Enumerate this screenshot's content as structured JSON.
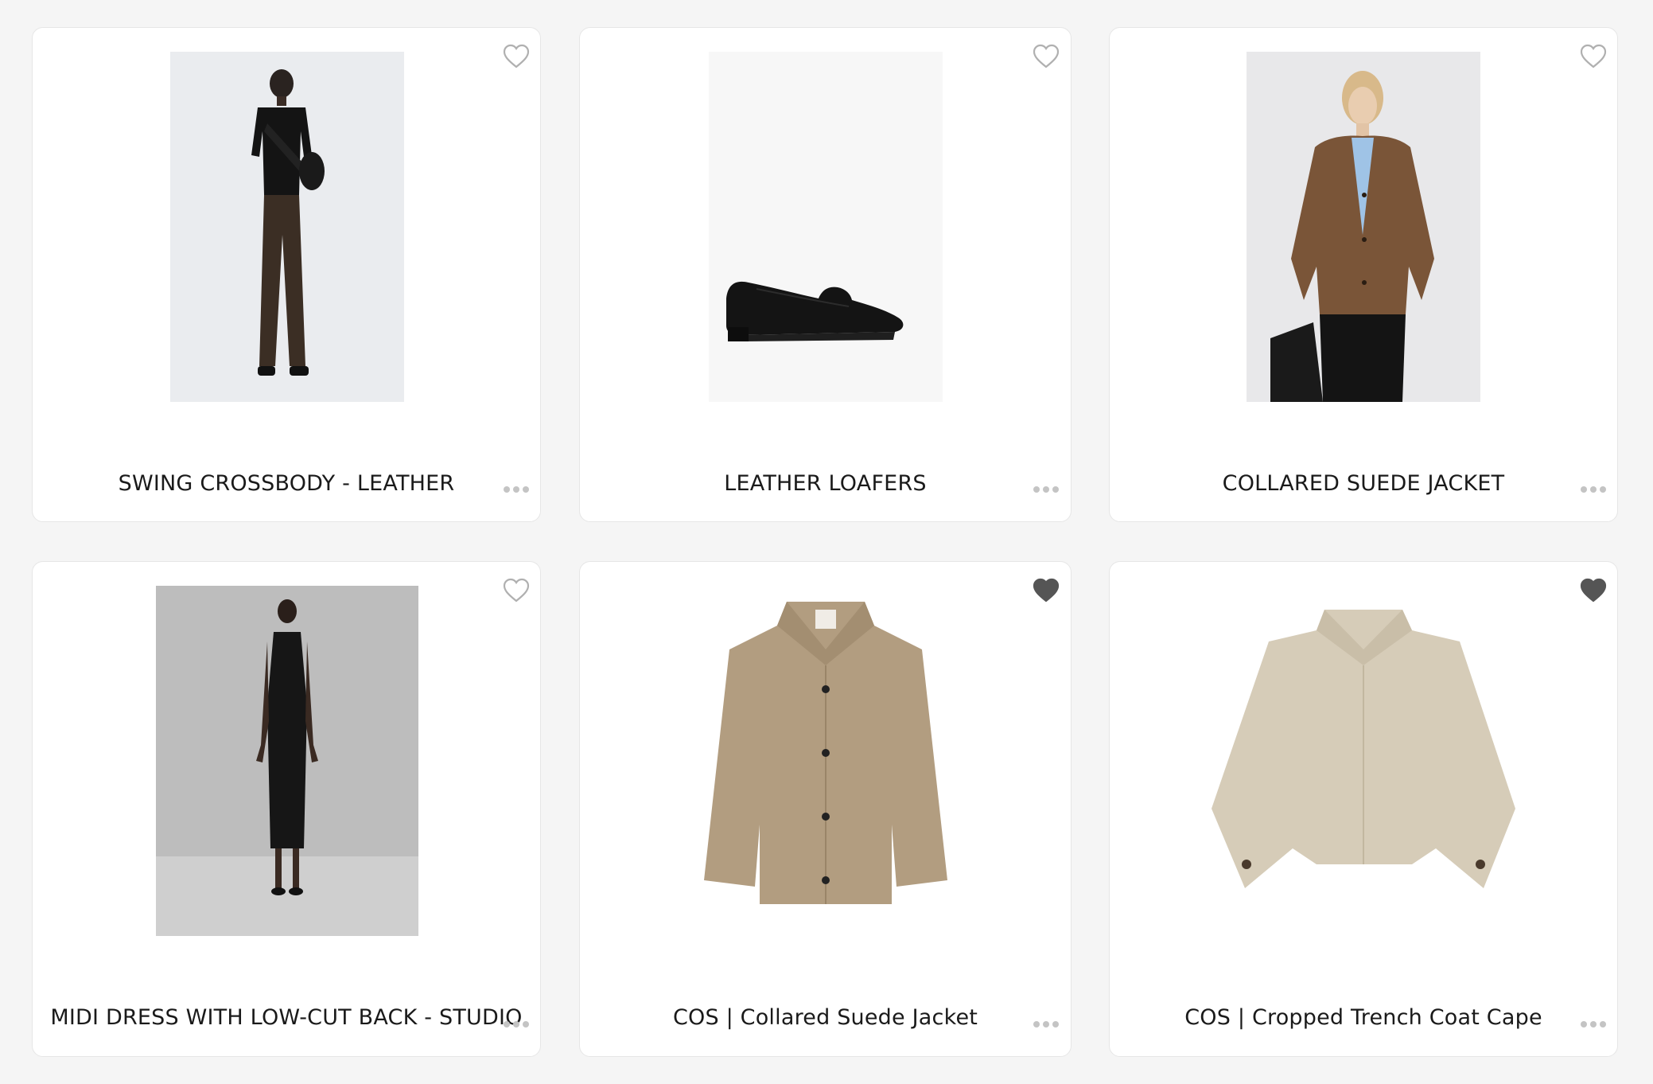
{
  "products": [
    {
      "title": "SWING CROSSBODY - LEATHER",
      "favorited": false,
      "image": "model-black-tee-brown-trousers-crossbody"
    },
    {
      "title": "LEATHER LOAFERS",
      "favorited": false,
      "image": "black-leather-loafer"
    },
    {
      "title": "COLLARED SUEDE JACKET",
      "favorited": false,
      "image": "model-brown-suede-jacket"
    },
    {
      "title": "MIDI DRESS WITH LOW-CUT BACK - STUDIO",
      "favorited": false,
      "image": "model-black-midi-dress"
    },
    {
      "title": "COS | Collared Suede Jacket",
      "favorited": true,
      "image": "beige-suede-jacket-flatlay"
    },
    {
      "title": "COS | Cropped Trench Coat Cape",
      "favorited": true,
      "image": "beige-trench-cape"
    }
  ],
  "icons": {
    "heart_outline": "heart-outline-icon",
    "heart_filled": "heart-filled-icon",
    "more": "more-dots-icon"
  },
  "colors": {
    "page_bg": "#f5f5f5",
    "card_bg": "#ffffff",
    "heart_outline": "#b0b0b0",
    "heart_filled": "#555555"
  }
}
